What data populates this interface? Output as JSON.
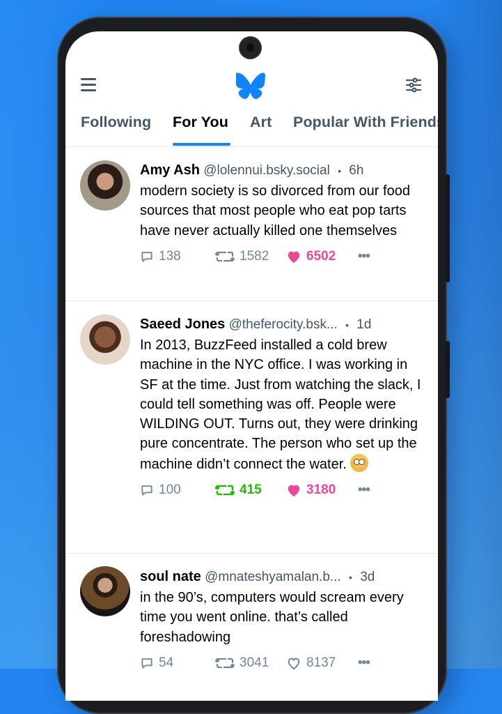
{
  "app": {
    "name": "Bluesky",
    "accent_color": "#1083fe"
  },
  "topbar": {
    "menu_icon": "hamburger-menu-icon",
    "logo": "butterfly-logo",
    "filter_icon": "feed-settings-sliders-icon"
  },
  "tabs": [
    {
      "label": "Following",
      "active": false
    },
    {
      "label": "For You",
      "active": true
    },
    {
      "label": "Art",
      "active": false
    },
    {
      "label": "Popular With Friends",
      "label_visible": "Popular With Frienc",
      "active": false
    }
  ],
  "posts": [
    {
      "name": "Amy Ash",
      "handle": "@lolennui.bsky.social",
      "separator": "•",
      "time": "6h",
      "text": "modern society is so divorced from our food sources that most people who eat pop tarts have never actually killed one themselves",
      "replies": "138",
      "reposts": "1582",
      "likes": "6502",
      "liked": true,
      "reposted": false
    },
    {
      "name": "Saeed Jones",
      "handle": "@theferocity.bsk...",
      "separator": "•",
      "time": "1d",
      "text": "In 2013, BuzzFeed installed a cold brew machine in the NYC office. I was working in SF at the time. Just from watching the slack, I could tell something was off. People were WILDING OUT. Turns out, they were drinking pure concentrate. The person who set up the machine didn’t connect the water.",
      "emoji": "flushed-face",
      "replies": "100",
      "reposts": "415",
      "likes": "3180",
      "liked": true,
      "reposted": true
    },
    {
      "name": "soul nate",
      "handle": "@mnateshyamalan.b...",
      "separator": "•",
      "time": "3d",
      "text": "in the 90’s, computers would scream every time you went online. that’s called foreshadowing",
      "replies": "54",
      "reposts": "3041",
      "likes": "8137",
      "liked": false,
      "reposted": false
    }
  ],
  "colors": {
    "like": "#ec4899",
    "repost": "#20bc07",
    "muted": "#6f869f",
    "tab_inactive": "#42576c"
  },
  "more_label": "•••"
}
